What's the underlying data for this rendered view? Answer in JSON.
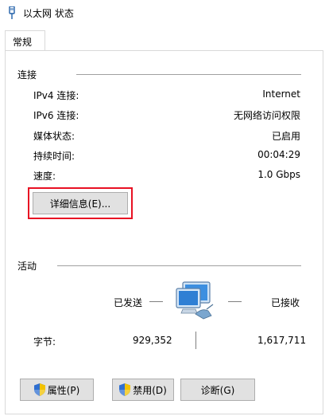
{
  "window": {
    "title": "以太网 状态",
    "icon": "ethernet-plug-icon"
  },
  "tabs": [
    {
      "label": "常规",
      "active": true
    }
  ],
  "connection": {
    "section_title": "连接",
    "rows": [
      {
        "label": "IPv4 连接:",
        "value": "Internet"
      },
      {
        "label": "IPv6 连接:",
        "value": "无网络访问权限"
      },
      {
        "label": "媒体状态:",
        "value": "已启用"
      },
      {
        "label": "持续时间:",
        "value": "00:04:29"
      },
      {
        "label": "速度:",
        "value": "1.0 Gbps"
      }
    ],
    "details_button": "详细信息(E)..."
  },
  "activity": {
    "section_title": "活动",
    "sent_label": "已发送",
    "received_label": "已接收",
    "bytes_label": "字节:",
    "bytes_sent": "929,352",
    "bytes_received": "1,617,711",
    "icon": "network-computer-icon"
  },
  "buttons": {
    "properties": "属性(P)",
    "disable": "禁用(D)",
    "diagnose": "诊断(G)"
  },
  "colors": {
    "highlight": "#e81123",
    "button_bg": "#e1e1e1",
    "button_border": "#adadad",
    "rule": "#a0a0a0"
  }
}
